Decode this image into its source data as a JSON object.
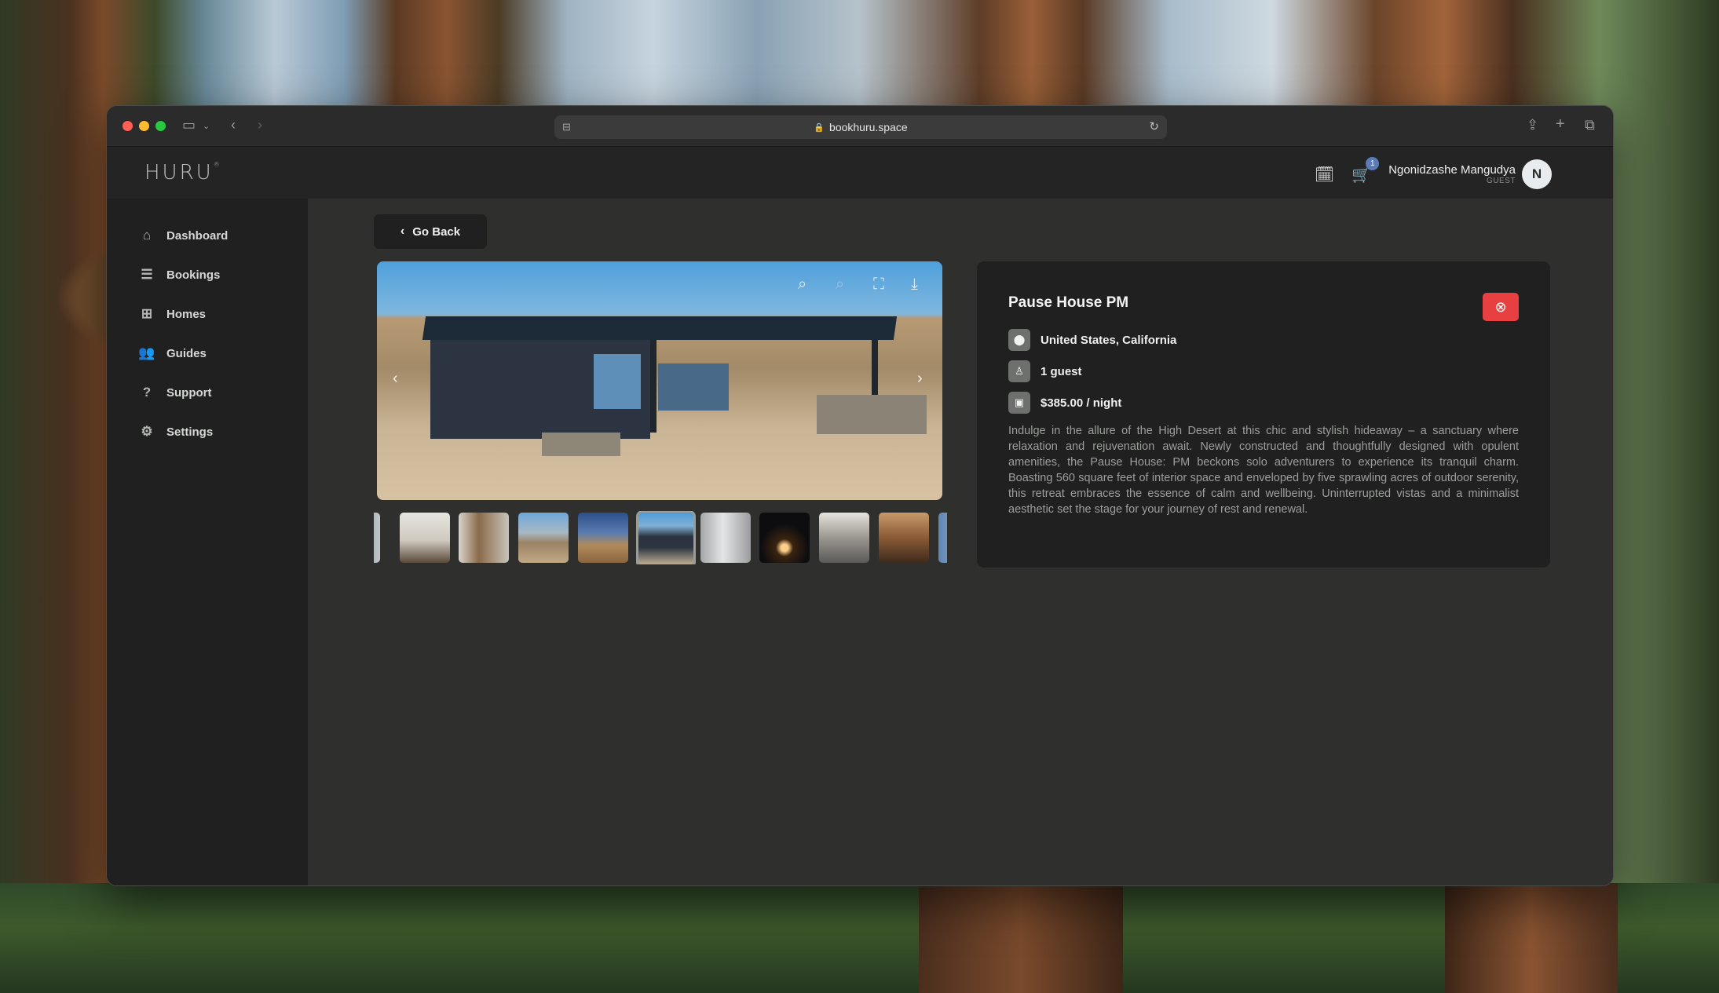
{
  "browser": {
    "url": "bookhuru.space"
  },
  "header": {
    "logo": "HURU",
    "logo_sup": "®",
    "cart_count": "1",
    "user_name": "Ngonidzashe Mangudya",
    "user_role": "GUEST",
    "avatar_initial": "N"
  },
  "sidebar": {
    "items": [
      {
        "label": "Dashboard",
        "icon": "home-icon"
      },
      {
        "label": "Bookings",
        "icon": "list-icon"
      },
      {
        "label": "Homes",
        "icon": "grid-icon"
      },
      {
        "label": "Guides",
        "icon": "users-icon"
      },
      {
        "label": "Support",
        "icon": "help-circle-icon"
      },
      {
        "label": "Settings",
        "icon": "gear-icon"
      }
    ]
  },
  "main": {
    "go_back_label": "Go Back",
    "property": {
      "title": "Pause House PM",
      "location": "United States, California",
      "guests": "1 guest",
      "price": "$385.00 / night",
      "description": "Indulge in the allure of the High Desert at this chic and stylish hideaway – a sanctuary where relaxation and rejuvenation await. Newly constructed and thoughtfully designed with opulent amenities, the Pause House: PM beckons solo adventurers to experience its tranquil charm. Boasting 560 square feet of interior space and enveloped by five sprawling acres of outdoor serenity, this retreat embraces the essence of calm and wellbeing. Uninterrupted vistas and a minimalist aesthetic set the stage for your journey of rest and renewal."
    },
    "gallery": {
      "selected_index": 5
    }
  },
  "colors": {
    "remove_button": "#e84040",
    "sidebar_bg": "#1f201f",
    "main_bg": "#2f302e"
  }
}
